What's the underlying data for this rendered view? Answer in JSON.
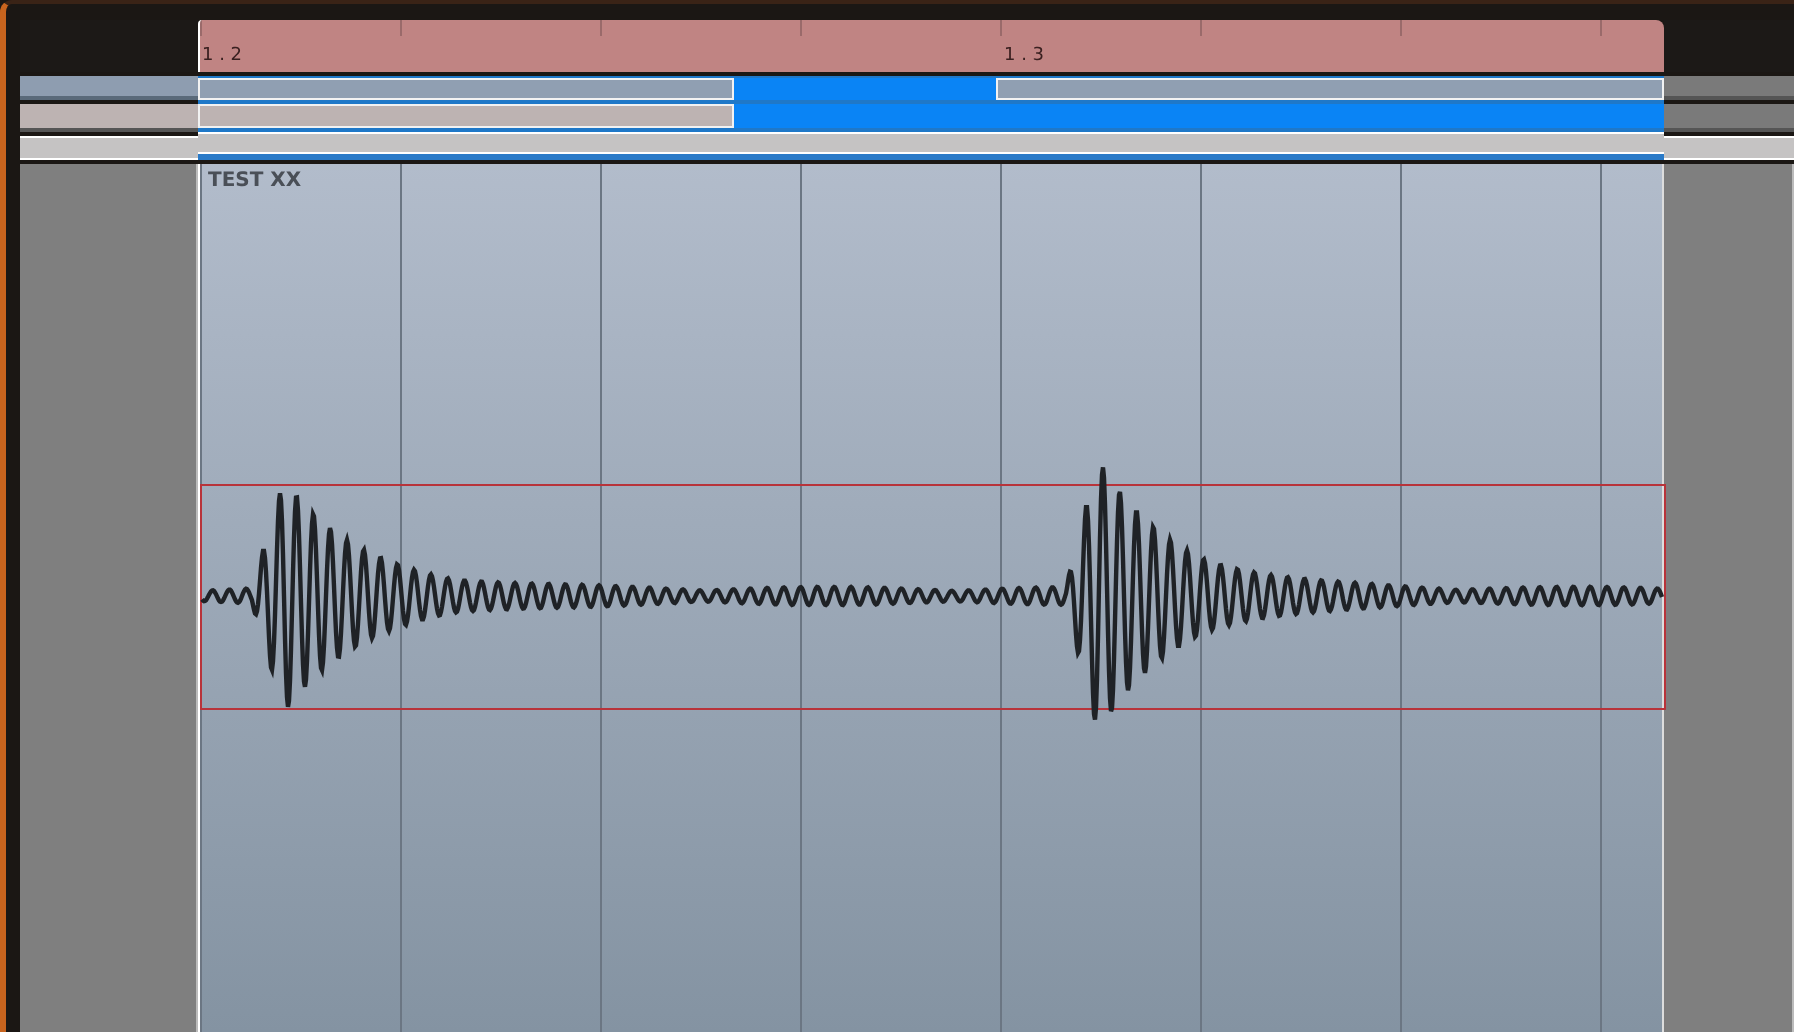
{
  "ruler": {
    "markers": [
      {
        "label": "1 . 2"
      },
      {
        "label": "1 . 3"
      }
    ]
  },
  "clip": {
    "title": "TEST XX"
  }
}
